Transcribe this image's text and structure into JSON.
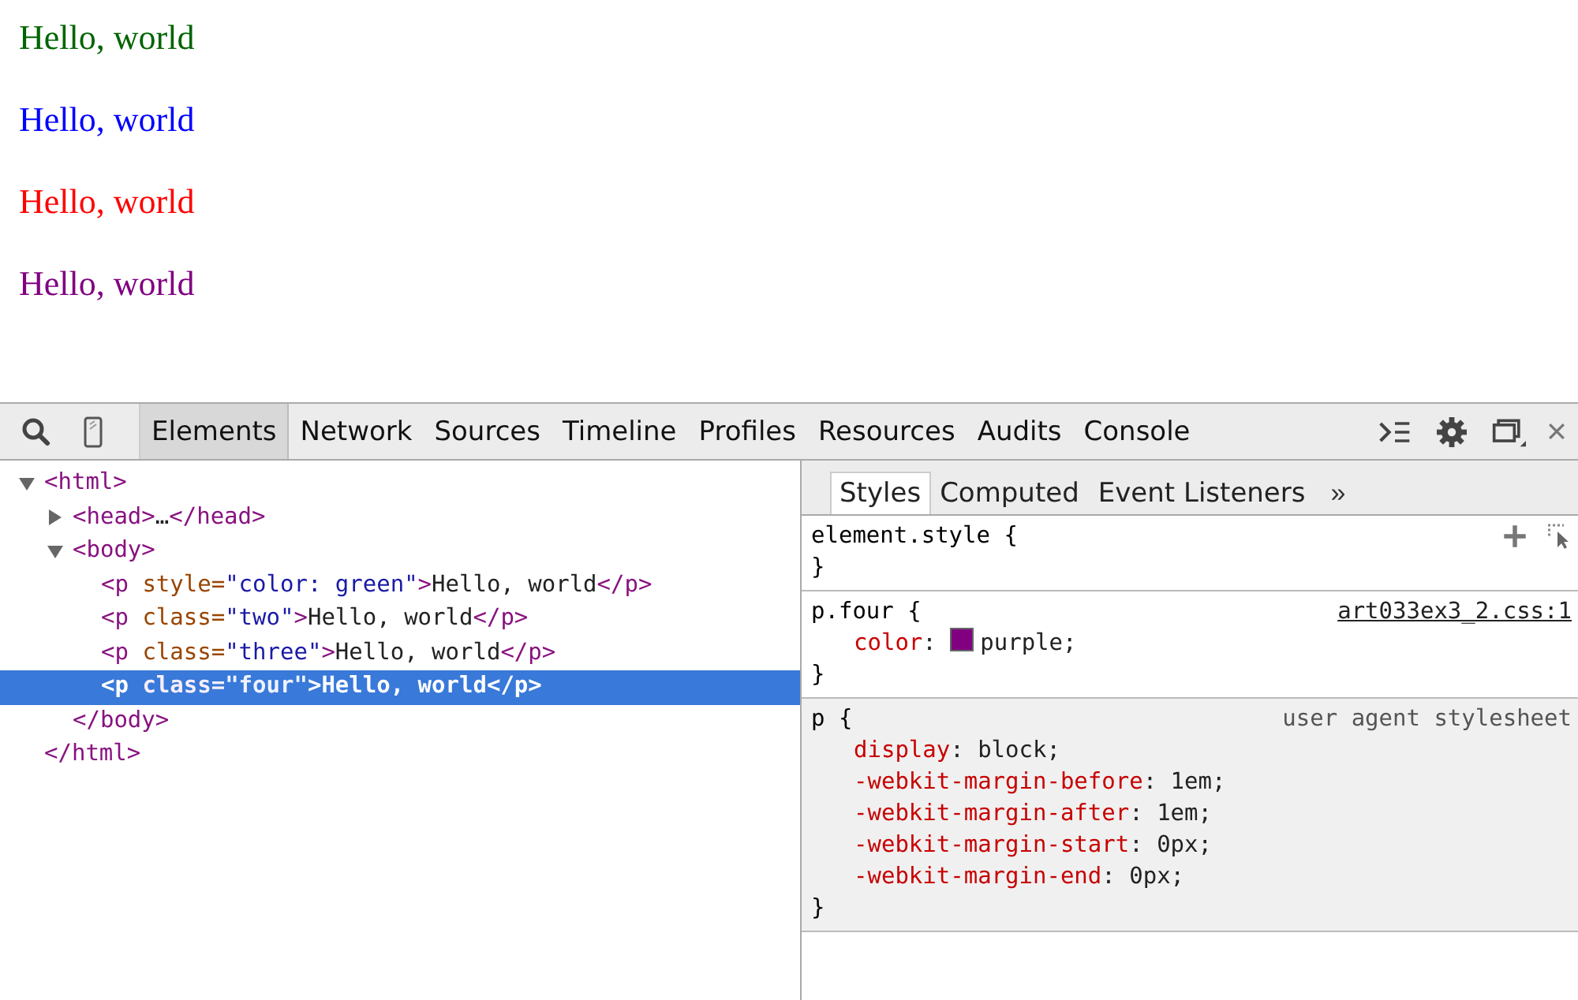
{
  "page": {
    "paragraphs": [
      {
        "text": "Hello, world",
        "color": "#006400"
      },
      {
        "text": "Hello, world",
        "color": "#0000ff"
      },
      {
        "text": "Hello, world",
        "color": "#ff0000"
      },
      {
        "text": "Hello, world",
        "color": "#800080"
      }
    ]
  },
  "toolbar": {
    "tabs": [
      {
        "label": "Elements",
        "selected": true
      },
      {
        "label": "Network",
        "selected": false
      },
      {
        "label": "Sources",
        "selected": false
      },
      {
        "label": "Timeline",
        "selected": false
      },
      {
        "label": "Profiles",
        "selected": false
      },
      {
        "label": "Resources",
        "selected": false
      },
      {
        "label": "Audits",
        "selected": false
      },
      {
        "label": "Console",
        "selected": false
      }
    ]
  },
  "dom_tree": [
    {
      "selected": false,
      "expanded": true,
      "open": [
        {
          "kind": "tag",
          "text": "<html>"
        }
      ],
      "close": [
        {
          "kind": "tag",
          "text": "</html>"
        }
      ],
      "children": [
        {
          "selected": false,
          "expanded": false,
          "open": [
            {
              "kind": "tag",
              "text": "<head>"
            },
            {
              "kind": "text",
              "text": "…"
            },
            {
              "kind": "tag",
              "text": "</head>"
            }
          ]
        },
        {
          "selected": false,
          "expanded": true,
          "open": [
            {
              "kind": "tag",
              "text": "<body>"
            }
          ],
          "close": [
            {
              "kind": "tag",
              "text": "</body>"
            }
          ],
          "children": [
            {
              "selected": false,
              "open": [
                {
                  "kind": "tag",
                  "text": "<p"
                },
                {
                  "kind": "attr",
                  "text": " style="
                },
                {
                  "kind": "value",
                  "text": "\"color: green\""
                },
                {
                  "kind": "tag",
                  "text": ">"
                },
                {
                  "kind": "text",
                  "text": "Hello, world"
                },
                {
                  "kind": "tag",
                  "text": "</p>"
                }
              ]
            },
            {
              "selected": false,
              "open": [
                {
                  "kind": "tag",
                  "text": "<p"
                },
                {
                  "kind": "attr",
                  "text": " class="
                },
                {
                  "kind": "value",
                  "text": "\"two\""
                },
                {
                  "kind": "tag",
                  "text": ">"
                },
                {
                  "kind": "text",
                  "text": "Hello, world"
                },
                {
                  "kind": "tag",
                  "text": "</p>"
                }
              ]
            },
            {
              "selected": false,
              "open": [
                {
                  "kind": "tag",
                  "text": "<p"
                },
                {
                  "kind": "attr",
                  "text": " class="
                },
                {
                  "kind": "value",
                  "text": "\"three\""
                },
                {
                  "kind": "tag",
                  "text": ">"
                },
                {
                  "kind": "text",
                  "text": "Hello, world"
                },
                {
                  "kind": "tag",
                  "text": "</p>"
                }
              ]
            },
            {
              "selected": true,
              "open": [
                {
                  "kind": "tag",
                  "text": "<p"
                },
                {
                  "kind": "attr",
                  "text": " class="
                },
                {
                  "kind": "value",
                  "text": "\"four\""
                },
                {
                  "kind": "tag",
                  "text": ">"
                },
                {
                  "kind": "text",
                  "text": "Hello, world"
                },
                {
                  "kind": "tag",
                  "text": "</p>"
                }
              ]
            }
          ]
        }
      ]
    }
  ],
  "sidebar": {
    "tabs": [
      {
        "label": "Styles",
        "selected": true
      },
      {
        "label": "Computed",
        "selected": false
      },
      {
        "label": "Event Listeners",
        "selected": false
      }
    ],
    "more": "»",
    "rules": [
      {
        "kind": "inline",
        "selector": "element.style {",
        "close": "}"
      },
      {
        "kind": "author",
        "selector": "p.four {",
        "source": "art033ex3_2.css:1",
        "close": "}",
        "properties": [
          {
            "name": "color:",
            "value": "purple;",
            "color": "#800080"
          }
        ]
      },
      {
        "kind": "user-agent",
        "selector": "p {",
        "source": "user agent stylesheet",
        "close": "}",
        "properties": [
          {
            "name": "display:",
            "value": "block;"
          },
          {
            "name": "-webkit-margin-before:",
            "value": "1em;"
          },
          {
            "name": "-webkit-margin-after:",
            "value": "1em;"
          },
          {
            "name": "-webkit-margin-start:",
            "value": "0px;"
          },
          {
            "name": "-webkit-margin-end:",
            "value": "0px;"
          }
        ]
      }
    ]
  }
}
